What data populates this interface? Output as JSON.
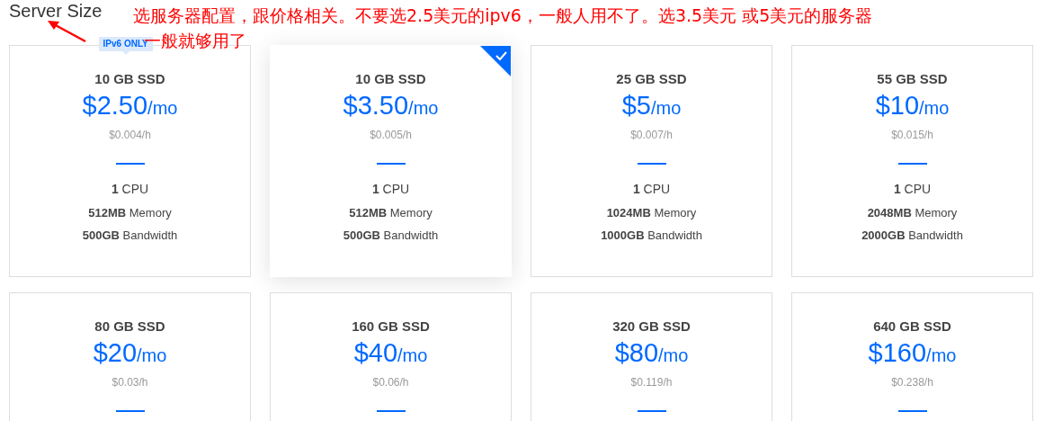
{
  "title": "Server Size",
  "annotation": {
    "lines": [
      "选服务器配置，跟价格相关。不要选2.5美元的ipv6，一般人用不了。选3.5美元 或5美元的服务器",
      "一般就够用了"
    ]
  },
  "plans": [
    {
      "disk": "10 GB SSD",
      "price": "$2.50",
      "unit": "/mo",
      "hourly": "$0.004/h",
      "selected": false,
      "badge": "IPv6 ONLY",
      "specs": [
        "**1** CPU",
        "**512MB** Memory",
        "**500GB** Bandwidth"
      ]
    },
    {
      "disk": "10 GB SSD",
      "price": "$3.50",
      "unit": "/mo",
      "hourly": "$0.005/h",
      "selected": true,
      "specs": [
        "**1** CPU",
        "**512MB** Memory",
        "**500GB** Bandwidth"
      ]
    },
    {
      "disk": "25 GB SSD",
      "price": "$5",
      "unit": "/mo",
      "hourly": "$0.007/h",
      "selected": false,
      "specs": [
        "**1** CPU",
        "**1024MB** Memory",
        "**1000GB** Bandwidth"
      ]
    },
    {
      "disk": "55 GB SSD",
      "price": "$10",
      "unit": "/mo",
      "hourly": "$0.015/h",
      "selected": false,
      "specs": [
        "**1** CPU",
        "**2048MB** Memory",
        "**2000GB** Bandwidth"
      ]
    },
    {
      "disk": "80 GB SSD",
      "price": "$20",
      "unit": "/mo",
      "hourly": "$0.03/h",
      "selected": false
    },
    {
      "disk": "160 GB SSD",
      "price": "$40",
      "unit": "/mo",
      "hourly": "$0.06/h",
      "selected": false
    },
    {
      "disk": "320 GB SSD",
      "price": "$80",
      "unit": "/mo",
      "hourly": "$0.119/h",
      "selected": false
    },
    {
      "disk": "640 GB SSD",
      "price": "$160",
      "unit": "/mo",
      "hourly": "$0.238/h",
      "selected": false
    }
  ]
}
